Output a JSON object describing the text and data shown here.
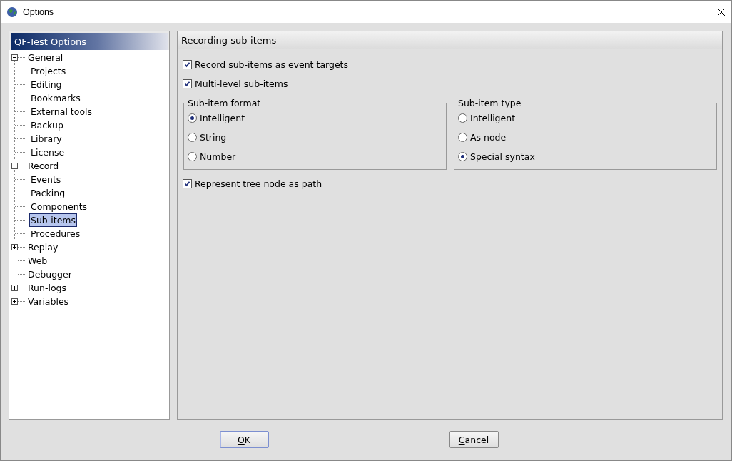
{
  "window": {
    "title": "Options"
  },
  "sidebar": {
    "title": "QF-Test Options",
    "tree": [
      {
        "label": "General",
        "expanded": true,
        "selected": false,
        "children": [
          {
            "label": "Projects",
            "selected": false
          },
          {
            "label": "Editing",
            "selected": false
          },
          {
            "label": "Bookmarks",
            "selected": false
          },
          {
            "label": "External tools",
            "selected": false
          },
          {
            "label": "Backup",
            "selected": false
          },
          {
            "label": "Library",
            "selected": false
          },
          {
            "label": "License",
            "selected": false
          }
        ]
      },
      {
        "label": "Record",
        "expanded": true,
        "selected": false,
        "children": [
          {
            "label": "Events",
            "selected": false
          },
          {
            "label": "Packing",
            "selected": false
          },
          {
            "label": "Components",
            "selected": false
          },
          {
            "label": "Sub-items",
            "selected": true
          },
          {
            "label": "Procedures",
            "selected": false
          }
        ]
      },
      {
        "label": "Replay",
        "expanded": false,
        "selected": false
      },
      {
        "label": "Web",
        "selected": false
      },
      {
        "label": "Debugger",
        "selected": false
      },
      {
        "label": "Run-logs",
        "expanded": false,
        "selected": false
      },
      {
        "label": "Variables",
        "expanded": false,
        "selected": false
      }
    ]
  },
  "panel": {
    "title": "Recording sub-items",
    "items": [
      {
        "kind": "checkbox",
        "label": "Record sub-items as event targets",
        "checked": true
      },
      {
        "kind": "checkbox",
        "label": "Multi-level sub-items",
        "checked": true
      },
      {
        "kind": "groups",
        "groups": [
          {
            "title": "Sub-item format",
            "options": [
              {
                "label": "Intelligent",
                "selected": true
              },
              {
                "label": "String",
                "selected": false
              },
              {
                "label": "Number",
                "selected": false
              }
            ]
          },
          {
            "title": "Sub-item type",
            "options": [
              {
                "label": "Intelligent",
                "selected": false
              },
              {
                "label": "As node",
                "selected": false
              },
              {
                "label": "Special syntax",
                "selected": true
              }
            ]
          }
        ]
      },
      {
        "kind": "checkbox",
        "label": "Represent tree node as path",
        "checked": true
      }
    ]
  },
  "buttons": [
    {
      "label": "OK",
      "default": true,
      "underline_first": true
    },
    {
      "label": "Cancel",
      "default": false,
      "underline_first": true
    }
  ]
}
